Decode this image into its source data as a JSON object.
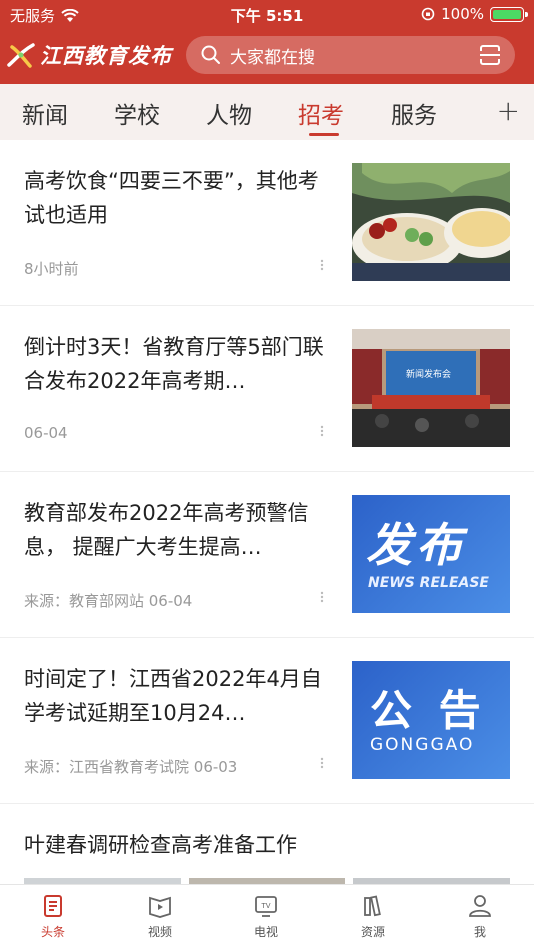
{
  "status_bar": {
    "carrier": "无服务",
    "time": "下午 5:51",
    "battery": "100%"
  },
  "app": {
    "name": "江西教育发布",
    "search_placeholder": "大家都在搜"
  },
  "tabs": [
    {
      "label": "新闻",
      "active": false
    },
    {
      "label": "学校",
      "active": false
    },
    {
      "label": "人物",
      "active": false
    },
    {
      "label": "招考",
      "active": true
    },
    {
      "label": "服务",
      "active": false
    }
  ],
  "tab_add": "+",
  "news": [
    {
      "title": "高考饮食“四要三不要”，其他考试也适用",
      "meta": "8小时前",
      "image": "food-photo"
    },
    {
      "title": "倒计时3天！省教育厅等5部门联合发布2022年高考期…",
      "meta": "06-04",
      "image": "press-conference-photo",
      "thumb_text": "新闻发布会"
    },
    {
      "title": "教育部发布2022年高考预警信息， 提醒广大考生提高…",
      "meta": "来源：教育部网站  06-04",
      "image": "release-banner",
      "thumb_text": "发布",
      "thumb_sub": "NEWS RELEASE"
    },
    {
      "title": "时间定了！江西省2022年4月自学考试延期至10月24…",
      "meta": "来源：江西省教育考试院  06-03",
      "image": "notice-banner",
      "thumb_text": "公 告",
      "thumb_sub": "GONGGAO"
    },
    {
      "title": "叶建春调研检查高考准备工作",
      "meta": "",
      "image": "gallery"
    }
  ],
  "bottom_nav": [
    {
      "label": "头条",
      "icon": "headline-icon",
      "active": true
    },
    {
      "label": "视频",
      "icon": "video-icon",
      "active": false
    },
    {
      "label": "电视",
      "icon": "tv-icon",
      "active": false
    },
    {
      "label": "资源",
      "icon": "resource-icon",
      "active": false
    },
    {
      "label": "我",
      "icon": "profile-icon",
      "active": false
    }
  ],
  "colors": {
    "brand": "#c93a2e",
    "tab_bg": "#f6f0ee",
    "banner_blue": "#3a7bd5"
  }
}
